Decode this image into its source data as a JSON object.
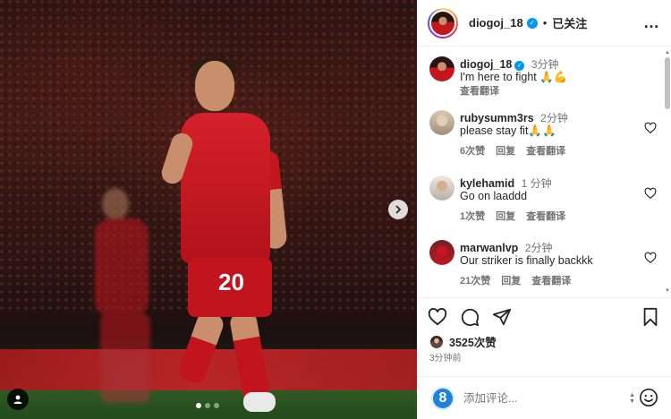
{
  "post": {
    "username": "diogoj_18",
    "follow_status": "已关注",
    "separator": "•",
    "more_label": "…",
    "likes": "3525次赞",
    "time_ago": "3分钟前"
  },
  "photo": {
    "shirt_number": "20",
    "carousel": {
      "total": 3,
      "active_index": 0
    }
  },
  "caption": {
    "username": "diogoj_18",
    "time": "3分钟",
    "text": "I'm here to fight 🙏💪",
    "translate_label": "查看翻译"
  },
  "comments": [
    {
      "username": "rubysumm3rs",
      "time": "2分钟",
      "text": "please stay fit🙏🙏",
      "likes": "6次赞",
      "reply": "回复",
      "translate": "查看翻译"
    },
    {
      "username": "kylehamid",
      "time": "1 分钟",
      "text": "Go on laaddd",
      "likes": "1次赞",
      "reply": "回复",
      "translate": "查看翻译"
    },
    {
      "username": "marwanlvp",
      "time": "2分钟",
      "text": "Our striker is finally backkk",
      "likes": "21次赞",
      "reply": "回复",
      "translate": "查看翻译"
    }
  ],
  "add_comment": {
    "avatar_letter": "8",
    "placeholder": "添加评论..."
  },
  "colors": {
    "verified_blue": "#0095f6",
    "liverpool_red": "#c8102e",
    "text_primary": "#262626",
    "text_secondary": "#737373"
  },
  "icons": [
    "verified-icon",
    "more-icon",
    "heart-icon",
    "comment-icon",
    "share-icon",
    "bookmark-icon",
    "emoji-icon",
    "chevron-right-icon",
    "user-tag-icon"
  ]
}
